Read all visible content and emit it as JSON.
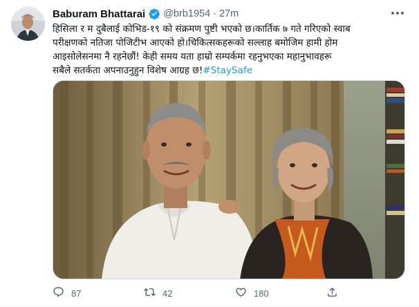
{
  "tweet": {
    "author_name": "Baburam Bhattarai",
    "handle": "@brb1954",
    "separator": "·",
    "time": "27m",
    "text_lines": [
      "हिसिला र म दुबैलाई कोभिड-१९ को संक्रमण पुष्टी भएको छ।कार्तिक ७ गते गरिएको स्वाब",
      "परीक्षणको नतिजा पोजिटीभ आएको हो।चिकित्सकहरूको सल्लाह बमोजिम हामी होम",
      "आइसोलेसनमा नै रहनेछौं! केही समय यता हाम्रो सम्पर्कमा रहनुभएका महानुभावहरू",
      "सबैले सतर्कता अपनाउनुहुन विशेष आग्रह छ!"
    ],
    "hashtag": "#StaySafe"
  },
  "actions": {
    "reply_count": "87",
    "retweet_count": "42",
    "like_count": "180"
  },
  "icons": {
    "verified": "verified-badge-icon",
    "more": "more-options-icon",
    "reply": "reply-icon",
    "retweet": "retweet-icon",
    "like": "heart-icon",
    "share": "share-icon"
  },
  "colors": {
    "accent": "#1d9bf0",
    "secondary_text": "#536471",
    "primary_text": "#0f1419"
  }
}
